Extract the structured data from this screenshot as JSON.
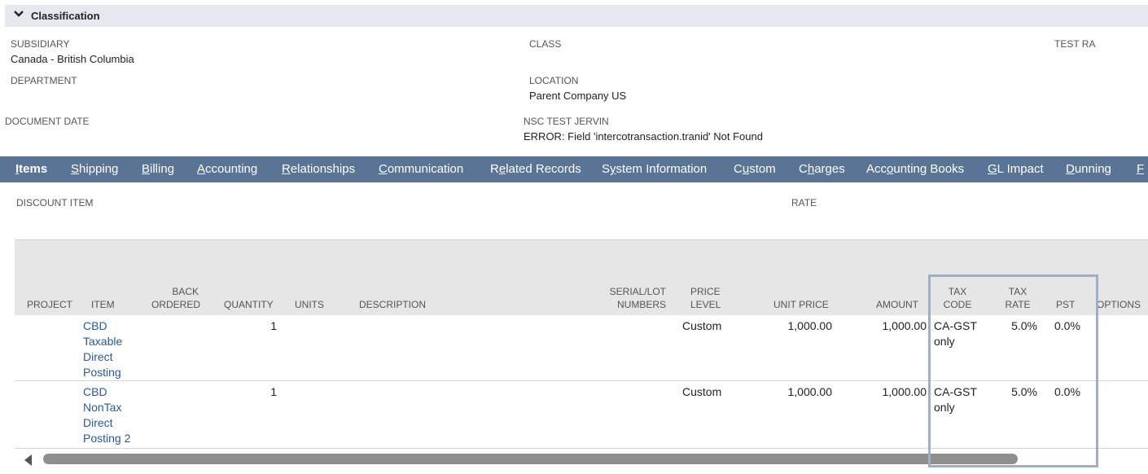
{
  "classification": {
    "title": "Classification",
    "subsidiary_label": "SUBSIDIARY",
    "subsidiary_value": "Canada - British Columbia",
    "class_label": "CLASS",
    "test_ra_label": "TEST RA",
    "department_label": "DEPARTMENT",
    "location_label": "LOCATION",
    "location_value": "Parent Company US",
    "document_date_label": "DOCUMENT DATE",
    "nsc_label": "NSC TEST JERVIN",
    "nsc_value": "ERROR: Field 'intercotransaction.tranid' Not Found"
  },
  "tabs": [
    {
      "pre": "",
      "u": "I",
      "post": "tems"
    },
    {
      "pre": "",
      "u": "S",
      "post": "hipping"
    },
    {
      "pre": "",
      "u": "B",
      "post": "illing"
    },
    {
      "pre": "",
      "u": "A",
      "post": "ccounting"
    },
    {
      "pre": "",
      "u": "R",
      "post": "elationships"
    },
    {
      "pre": "",
      "u": "C",
      "post": "ommunication"
    },
    {
      "pre": "R",
      "u": "e",
      "post": "lated Records"
    },
    {
      "pre": "S",
      "u": "y",
      "post": "stem Information"
    },
    {
      "pre": "C",
      "u": "u",
      "post": "stom"
    },
    {
      "pre": "C",
      "u": "h",
      "post": "arges"
    },
    {
      "pre": "Acc",
      "u": "o",
      "post": "unting Books"
    },
    {
      "pre": "",
      "u": "G",
      "post": "L Impact"
    },
    {
      "pre": "",
      "u": "D",
      "post": "unning"
    },
    {
      "pre": "",
      "u": "F",
      "post": ""
    }
  ],
  "items": {
    "discount_item_label": "DISCOUNT ITEM",
    "rate_label": "RATE",
    "columns": {
      "project": "PROJECT",
      "item": "ITEM",
      "back_ordered_1": "BACK",
      "back_ordered_2": "ORDERED",
      "quantity": "QUANTITY",
      "units": "UNITS",
      "description": "DESCRIPTION",
      "serial_1": "SERIAL/LOT",
      "serial_2": "NUMBERS",
      "price_level_1": "PRICE",
      "price_level_2": "LEVEL",
      "unit_price": "UNIT PRICE",
      "amount": "AMOUNT",
      "tax_code_1": "TAX",
      "tax_code_2": "CODE",
      "tax_rate_1": "TAX",
      "tax_rate_2": "RATE",
      "pst": "PST",
      "options": "OPTIONS"
    },
    "rows": [
      {
        "item_lines": [
          "CBD",
          "Taxable",
          "Direct",
          "Posting"
        ],
        "quantity": "1",
        "price_level": "Custom",
        "unit_price": "1,000.00",
        "amount": "1,000.00",
        "tax_code_lines": [
          "CA-GST",
          "only"
        ],
        "tax_rate": "5.0%",
        "pst": "0.0%"
      },
      {
        "item_lines": [
          "CBD",
          "NonTax",
          "Direct",
          "Posting 2"
        ],
        "quantity": "1",
        "price_level": "Custom",
        "unit_price": "1,000.00",
        "amount": "1,000.00",
        "tax_code_lines": [
          "CA-GST",
          "only"
        ],
        "tax_rate": "5.0%",
        "pst": "0.0%"
      }
    ]
  },
  "colors": {
    "tab_bar": "#5a7496",
    "link": "#275a9e",
    "header_bg": "#e5e9ef",
    "highlight": "#9fb0c6"
  }
}
